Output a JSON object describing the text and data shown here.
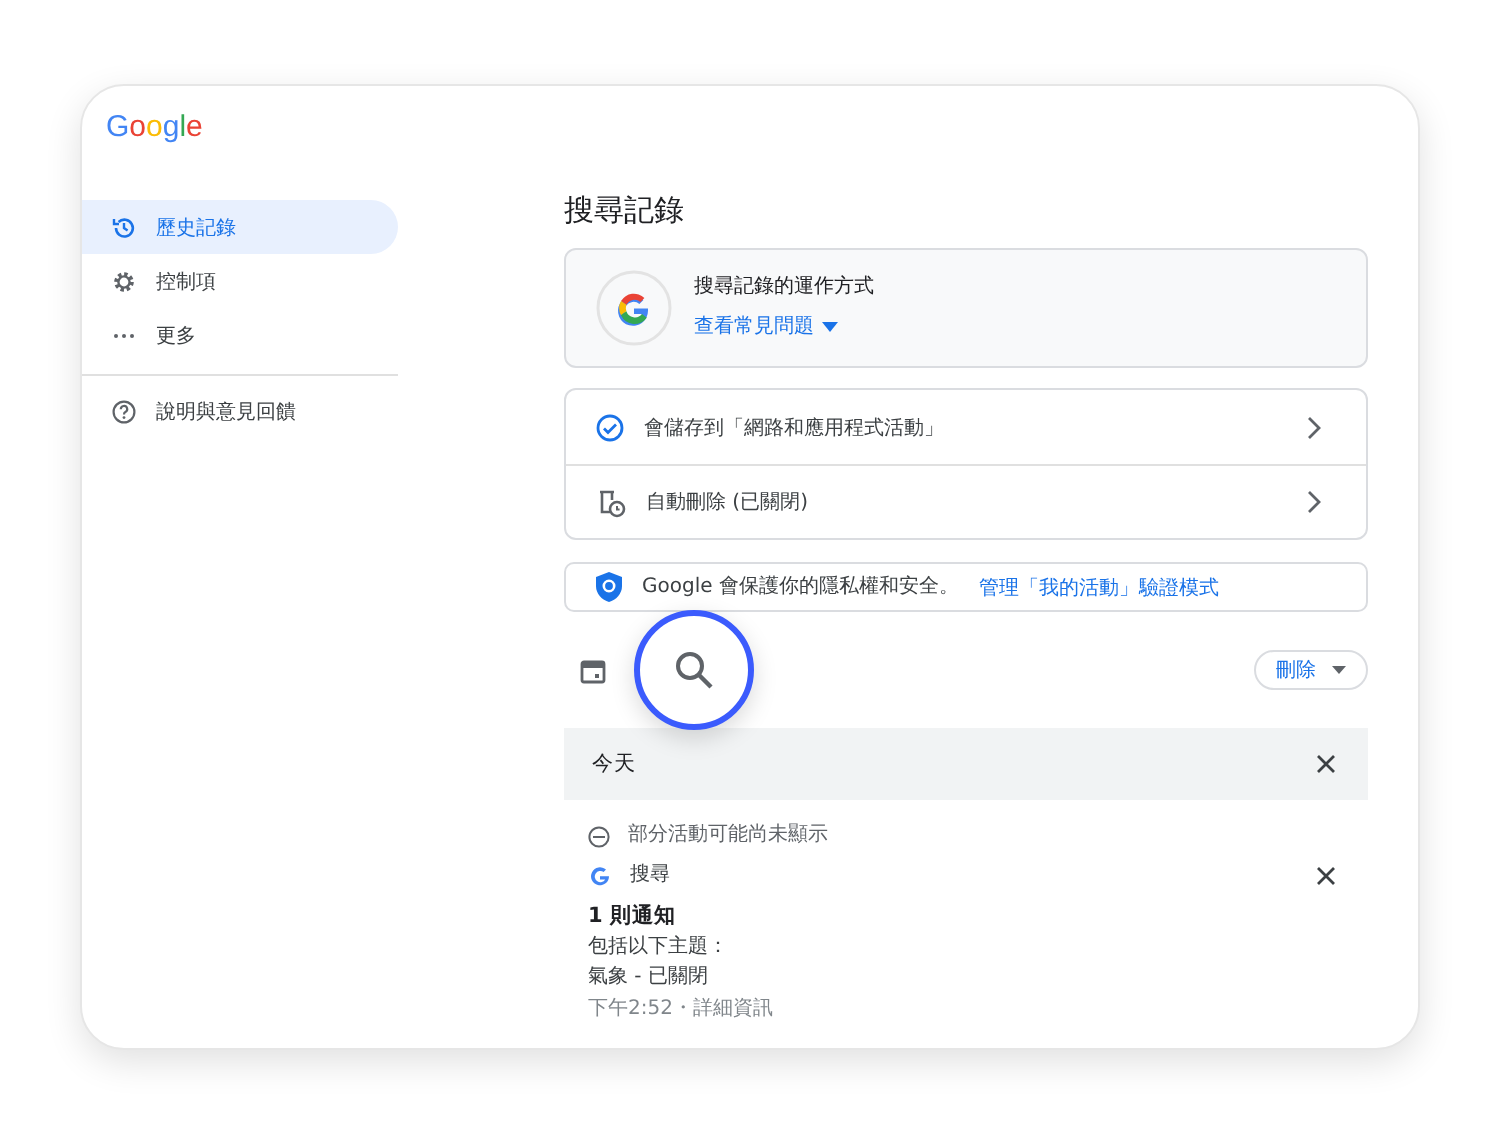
{
  "logo": "Google",
  "sidebar": {
    "items": [
      {
        "label": "歷史記錄",
        "kind": "history",
        "selected": true
      },
      {
        "label": "控制項",
        "kind": "gear",
        "selected": false
      },
      {
        "label": "更多",
        "kind": "more",
        "selected": false
      }
    ],
    "footer_items": [
      {
        "label": "說明與意見回饋",
        "kind": "help",
        "selected": false
      }
    ]
  },
  "page_title": "搜尋記錄",
  "info_card": {
    "title": "搜尋記錄的運作方式",
    "link": "查看常見問題"
  },
  "settings": [
    {
      "kind": "saved",
      "label": "會儲存到「網路和應用程式活動」"
    },
    {
      "kind": "autodelete",
      "label": "自動刪除 (已關閉)"
    }
  ],
  "privacy_banner": {
    "text": "Google 會保護你的隱私權和安全。",
    "link": "管理「我的活動」驗證模式"
  },
  "toolbar": {
    "delete_button": "刪除"
  },
  "day": {
    "title": "今天",
    "notice": "部分活動可能尚未顯示",
    "entry": {
      "source": "搜尋",
      "heading": "1 則通知",
      "lines": [
        "包括以下主題：",
        "氣象 - 已關閉"
      ],
      "meta": "下午2:52・詳細資訊"
    }
  }
}
